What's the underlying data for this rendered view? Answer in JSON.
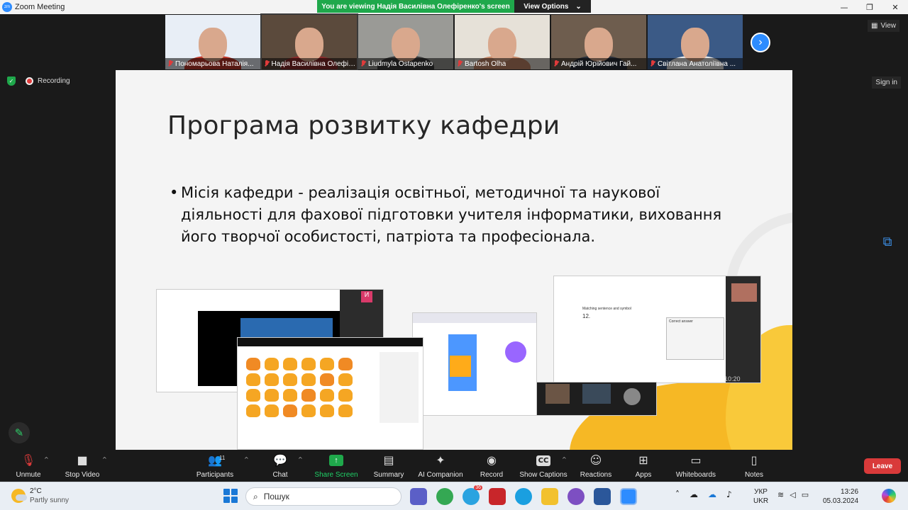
{
  "window": {
    "title": "Zoom Meeting",
    "minimize": "—",
    "restore": "❐",
    "close": "✕"
  },
  "banner": {
    "viewing_text": "You are viewing Надія  Василівна Олефіренко's screen",
    "view_options": "View Options",
    "caret": "⌄"
  },
  "participants_strip": [
    {
      "name": "Пономарьова Наталія...",
      "bg": "#e8eef6",
      "body": "#c0392b"
    },
    {
      "name": "Надія Василівна Олефіре...",
      "bg": "#5b4a3c",
      "body": "#8b2b2b"
    },
    {
      "name": "Liudmyla Ostapenko",
      "bg": "#9a9a96",
      "body": "#3c3c3c"
    },
    {
      "name": "Bartosh Olha",
      "bg": "#e6e1d8",
      "body": "#c78a6a"
    },
    {
      "name": "Андрій Юрійович Гай...",
      "bg": "#6e5d4e",
      "body": "#2a2f3a"
    },
    {
      "name": "Світлана Анатоліївна ...",
      "bg": "#3b5a86",
      "body": "#e6e6e6"
    }
  ],
  "next_arrow": "›",
  "view_button": {
    "label": "View",
    "icon": "grid-icon"
  },
  "sign_in": "Sign in",
  "recording": {
    "label": "Recording",
    "shield": "✓"
  },
  "slide": {
    "title": "Програма розвитку кафедри",
    "bullet_marker": "•",
    "bullet": "Місія кафедри -  реалізація освітньої, методичної та наукової діяльності для фахової підготовки учителя інформатики, виховання його творчої особистості, патріота та професіонала.",
    "shot_quiz_title": "Matching sentence and symbol",
    "shot_quiz_number": "12.",
    "shot_quiz_table_title": "Correct answer",
    "shot_time": "10:20"
  },
  "toolbar": {
    "unmute": "Unmute",
    "stop_video": "Stop Video",
    "participants": "Participants",
    "participants_count": "11",
    "chat": "Chat",
    "share_screen": "Share Screen",
    "summary": "Summary",
    "ai_companion": "AI Companion",
    "record": "Record",
    "show_captions": "Show Captions",
    "captions_icon": "CC",
    "reactions": "Reactions",
    "apps": "Apps",
    "whiteboards": "Whiteboards",
    "notes": "Notes",
    "leave": "Leave",
    "caret": "^"
  },
  "taskbar": {
    "temperature": "2°C",
    "condition": "Partly sunny",
    "search_placeholder": "Пошук",
    "badge": "36",
    "lang_top": "УКР",
    "lang_bottom": "UKR",
    "time": "13:26",
    "date": "05.03.2024"
  }
}
